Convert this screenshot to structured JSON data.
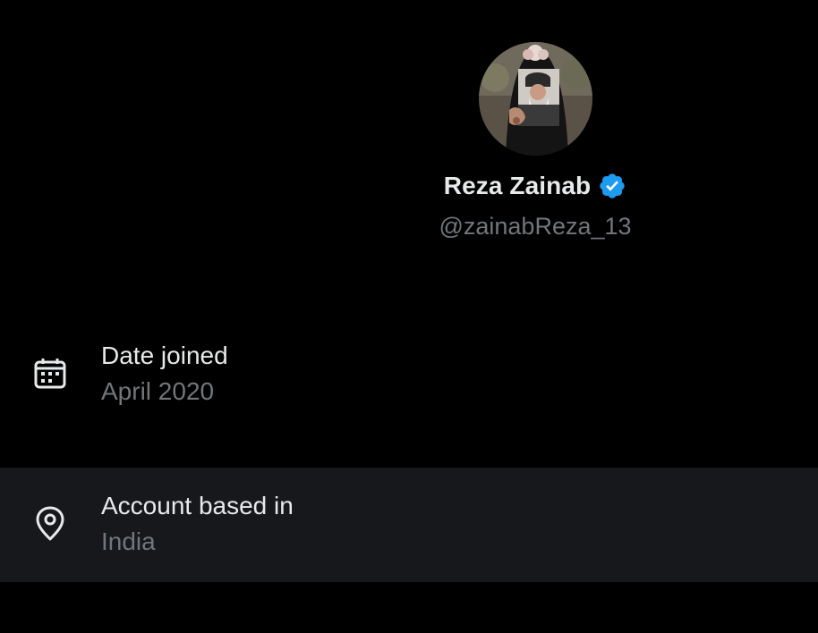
{
  "profile": {
    "display_name": "Reza Zainab",
    "handle": "@zainabReza_13",
    "verified_icon": "verified-badge-icon",
    "avatar": "avatar"
  },
  "about": {
    "items": [
      {
        "icon": "calendar-icon",
        "title": "Date joined",
        "value": "April 2020"
      },
      {
        "icon": "location-pin-icon",
        "title": "Account based in",
        "value": "India"
      }
    ]
  },
  "colors": {
    "background": "#000000",
    "row_highlight": "#16181c",
    "primary_text": "#e7e9ea",
    "secondary_text": "#71767b",
    "verified_blue": "#1d9bf0"
  }
}
